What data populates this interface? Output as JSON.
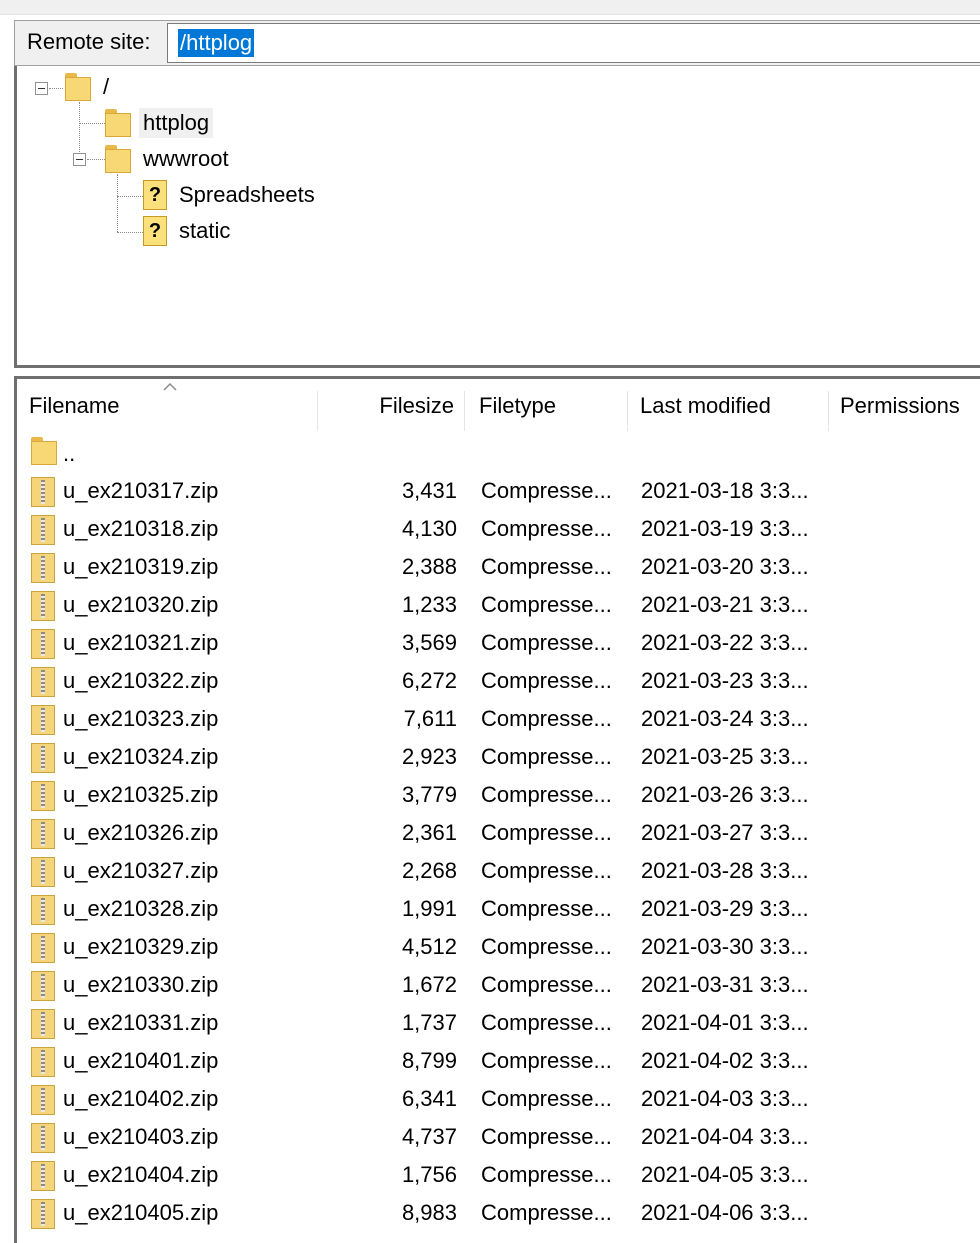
{
  "remote_site": {
    "label": "Remote site:",
    "path": "/httplog"
  },
  "tree": {
    "root": {
      "label": "/"
    },
    "items": [
      {
        "label": "httplog",
        "icon": "folder-icon"
      },
      {
        "label": "wwwroot",
        "icon": "folder-icon"
      },
      {
        "label": "Spreadsheets",
        "icon": "unknown-folder-icon",
        "glyph": "?"
      },
      {
        "label": "static",
        "icon": "unknown-folder-icon",
        "glyph": "?"
      }
    ]
  },
  "file_list": {
    "columns": [
      "Filename",
      "Filesize",
      "Filetype",
      "Last modified",
      "Permissions"
    ],
    "parent_dir": "..",
    "rows": [
      {
        "name": "u_ex210317.zip",
        "size": "3,431",
        "type": "Compresse...",
        "modified": "2021-03-18 3:3..."
      },
      {
        "name": "u_ex210318.zip",
        "size": "4,130",
        "type": "Compresse...",
        "modified": "2021-03-19 3:3..."
      },
      {
        "name": "u_ex210319.zip",
        "size": "2,388",
        "type": "Compresse...",
        "modified": "2021-03-20 3:3..."
      },
      {
        "name": "u_ex210320.zip",
        "size": "1,233",
        "type": "Compresse...",
        "modified": "2021-03-21 3:3..."
      },
      {
        "name": "u_ex210321.zip",
        "size": "3,569",
        "type": "Compresse...",
        "modified": "2021-03-22 3:3..."
      },
      {
        "name": "u_ex210322.zip",
        "size": "6,272",
        "type": "Compresse...",
        "modified": "2021-03-23 3:3..."
      },
      {
        "name": "u_ex210323.zip",
        "size": "7,611",
        "type": "Compresse...",
        "modified": "2021-03-24 3:3..."
      },
      {
        "name": "u_ex210324.zip",
        "size": "2,923",
        "type": "Compresse...",
        "modified": "2021-03-25 3:3..."
      },
      {
        "name": "u_ex210325.zip",
        "size": "3,779",
        "type": "Compresse...",
        "modified": "2021-03-26 3:3..."
      },
      {
        "name": "u_ex210326.zip",
        "size": "2,361",
        "type": "Compresse...",
        "modified": "2021-03-27 3:3..."
      },
      {
        "name": "u_ex210327.zip",
        "size": "2,268",
        "type": "Compresse...",
        "modified": "2021-03-28 3:3..."
      },
      {
        "name": "u_ex210328.zip",
        "size": "1,991",
        "type": "Compresse...",
        "modified": "2021-03-29 3:3..."
      },
      {
        "name": "u_ex210329.zip",
        "size": "4,512",
        "type": "Compresse...",
        "modified": "2021-03-30 3:3..."
      },
      {
        "name": "u_ex210330.zip",
        "size": "1,672",
        "type": "Compresse...",
        "modified": "2021-03-31 3:3..."
      },
      {
        "name": "u_ex210331.zip",
        "size": "1,737",
        "type": "Compresse...",
        "modified": "2021-04-01 3:3..."
      },
      {
        "name": "u_ex210401.zip",
        "size": "8,799",
        "type": "Compresse...",
        "modified": "2021-04-02 3:3..."
      },
      {
        "name": "u_ex210402.zip",
        "size": "6,341",
        "type": "Compresse...",
        "modified": "2021-04-03 3:3..."
      },
      {
        "name": "u_ex210403.zip",
        "size": "4,737",
        "type": "Compresse...",
        "modified": "2021-04-04 3:3..."
      },
      {
        "name": "u_ex210404.zip",
        "size": "1,756",
        "type": "Compresse...",
        "modified": "2021-04-05 3:3..."
      },
      {
        "name": "u_ex210405.zip",
        "size": "8,983",
        "type": "Compresse...",
        "modified": "2021-04-06 3:3..."
      }
    ]
  },
  "colors": {
    "selection": "#0078d7",
    "folder": "#f8d775",
    "border": "#6f6f6f"
  }
}
